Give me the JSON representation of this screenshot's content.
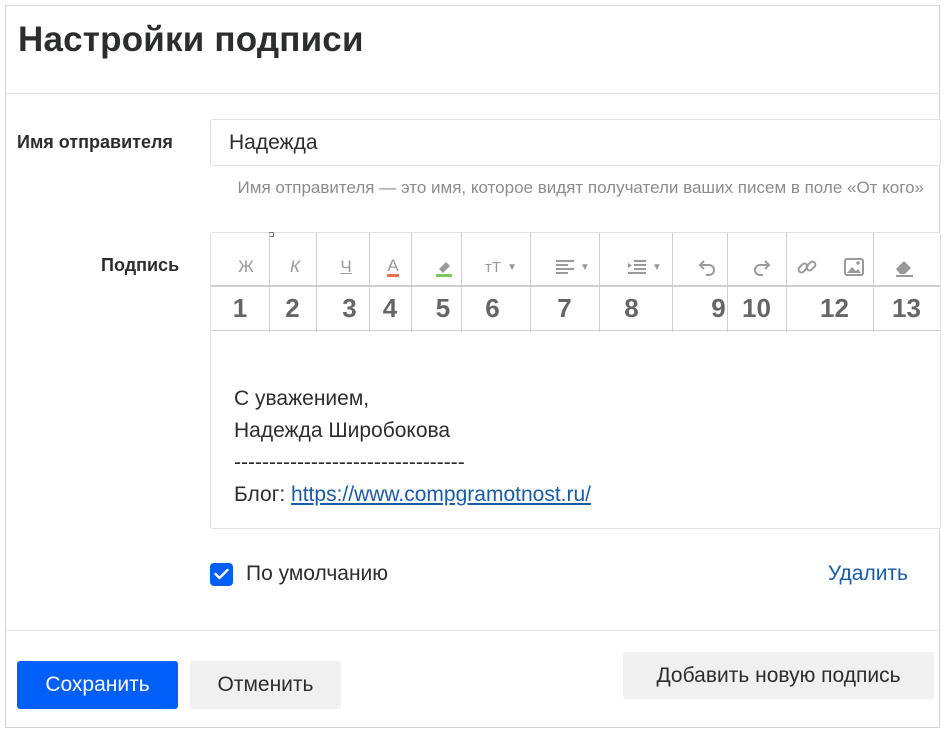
{
  "header": {
    "title": "Настройки подписи"
  },
  "sender": {
    "label": "Имя отправителя",
    "value": "Надежда",
    "hint": "Имя отправителя — это имя, которое видят получатели ваших писем в поле «От кого»"
  },
  "signature": {
    "label": "Подпись",
    "toolbar": [
      {
        "icon": "bold-icon",
        "glyph": "Ж",
        "number": "1"
      },
      {
        "icon": "italic-icon",
        "glyph": "К",
        "number": "2"
      },
      {
        "icon": "underline-icon",
        "glyph": "Ч",
        "number": "3"
      },
      {
        "icon": "text-color-icon",
        "glyph": "A",
        "number": "4"
      },
      {
        "icon": "highlight-icon",
        "glyph": "",
        "number": "5"
      },
      {
        "icon": "font-size-icon",
        "glyph": "тТ",
        "number": "6"
      },
      {
        "icon": "align-icon",
        "glyph": "",
        "number": "7"
      },
      {
        "icon": "indent-icon",
        "glyph": "",
        "number": "8"
      },
      {
        "icon": "undo-icon",
        "glyph": "",
        "number": "9"
      },
      {
        "icon": "redo-icon",
        "glyph": "",
        "number": "10"
      },
      {
        "icon": "link-icon",
        "glyph": "",
        "number": ""
      },
      {
        "icon": "image-icon",
        "glyph": "",
        "number": "12"
      },
      {
        "icon": "eraser-icon",
        "glyph": "",
        "number": "13"
      }
    ],
    "colors": {
      "text_color_underline": "#e8734a",
      "highlight_underline": "#7bc95a"
    },
    "body": {
      "line1": "С уважением,",
      "line2": "Надежда Широбокова",
      "line3": "---------------------------------",
      "blog_label": "Блог: ",
      "blog_link": "https://www.compgramotnost.ru/"
    }
  },
  "default_checkbox": {
    "label": "По умолчанию",
    "checked": true
  },
  "delete_label": "Удалить",
  "buttons": {
    "save": "Сохранить",
    "cancel": "Отменить",
    "add_new": "Добавить новую подпись"
  },
  "colors": {
    "accent": "#005ff9",
    "link": "#1a5aa6"
  }
}
